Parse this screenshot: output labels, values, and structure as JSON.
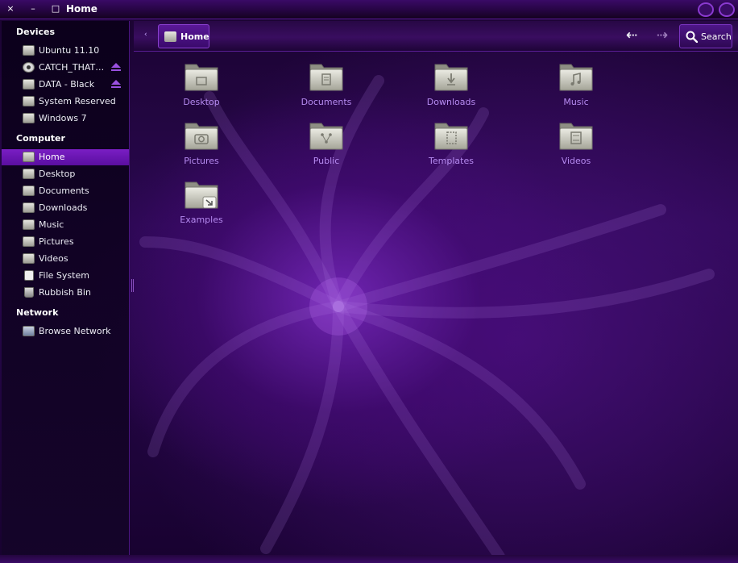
{
  "window": {
    "title": "Home",
    "close_glyph": "×",
    "minimize_glyph": "–",
    "maximize_glyph": "□"
  },
  "colors": {
    "accent": "#7a1ec4",
    "label": "#b58af0",
    "eject": "#9a50e0"
  },
  "sidebar": {
    "sections": [
      {
        "heading": "Devices",
        "items": [
          {
            "label": "Ubuntu 11.10",
            "icon": "drive-icon",
            "eject": false
          },
          {
            "label": "CATCH_THAT…",
            "icon": "optical-disc-icon",
            "eject": true
          },
          {
            "label": "DATA - Black",
            "icon": "drive-icon",
            "eject": true
          },
          {
            "label": "System Reserved",
            "icon": "drive-icon",
            "eject": false
          },
          {
            "label": "Windows 7",
            "icon": "drive-icon",
            "eject": false
          }
        ]
      },
      {
        "heading": "Computer",
        "items": [
          {
            "label": "Home",
            "icon": "home-folder-icon",
            "active": true
          },
          {
            "label": "Desktop",
            "icon": "desktop-folder-icon"
          },
          {
            "label": "Documents",
            "icon": "documents-folder-icon"
          },
          {
            "label": "Downloads",
            "icon": "downloads-folder-icon"
          },
          {
            "label": "Music",
            "icon": "music-folder-icon"
          },
          {
            "label": "Pictures",
            "icon": "pictures-folder-icon"
          },
          {
            "label": "Videos",
            "icon": "videos-folder-icon"
          },
          {
            "label": "File System",
            "icon": "file-system-icon"
          },
          {
            "label": "Rubbish Bin",
            "icon": "trash-icon"
          }
        ]
      },
      {
        "heading": "Network",
        "items": [
          {
            "label": "Browse Network",
            "icon": "network-icon"
          }
        ]
      }
    ]
  },
  "toolbar": {
    "crumb_arrow": "‹",
    "breadcrumb": "Home",
    "back_glyph": "⇠",
    "forward_glyph": "⇢",
    "search_label": "Search"
  },
  "content": {
    "items": [
      {
        "label": "Desktop",
        "emblem": "desktop"
      },
      {
        "label": "Documents",
        "emblem": "documents"
      },
      {
        "label": "Downloads",
        "emblem": "downloads"
      },
      {
        "label": "Music",
        "emblem": "music"
      },
      {
        "label": "Pictures",
        "emblem": "pictures"
      },
      {
        "label": "Public",
        "emblem": "public"
      },
      {
        "label": "Templates",
        "emblem": "templates"
      },
      {
        "label": "Videos",
        "emblem": "videos"
      },
      {
        "label": "Examples",
        "emblem": "link"
      }
    ]
  }
}
